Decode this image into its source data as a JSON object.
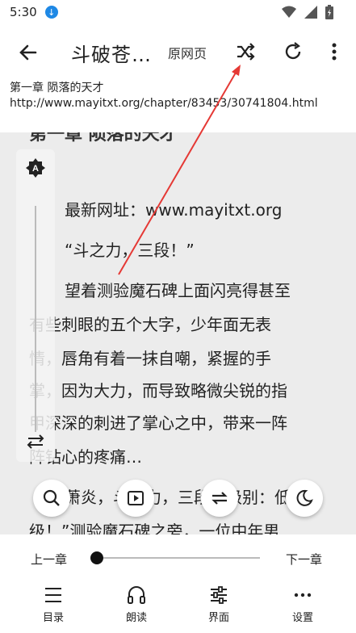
{
  "status": {
    "time": "5:30"
  },
  "toolbar": {
    "title": "斗破苍…",
    "origin_label": "原网页"
  },
  "url_info": {
    "chapter": "第一章 陨落的天才",
    "url": "http://www.mayitxt.org/chapter/83453/30741804.html"
  },
  "reader": {
    "heading": "第一章 陨落的天才",
    "lines": [
      "最新网址：www.mayitxt.org",
      "“斗之力，三段！”",
      "望着测验魔石碑上面闪亮得甚至",
      "有些刺眼的五个大字，少年面无表",
      "情，唇角有着一抹自嘲，紧握的手",
      "掌，因为大力，而导致略微尖锐的指",
      "甲深深的刺进了掌心之中，带来一阵",
      "阵钻心的疼痛…",
      "萧炎，斗之力，三段！级别：低",
      "级！”测验魔石碑之旁，一位中年男"
    ]
  },
  "bottom": {
    "prev_label": "上一章",
    "next_label": "下一章",
    "progress": 0.0,
    "nav": [
      {
        "label": "目录",
        "icon": "list-icon"
      },
      {
        "label": "朗读",
        "icon": "headphones-icon"
      },
      {
        "label": "界面",
        "icon": "sliders-icon"
      },
      {
        "label": "设置",
        "icon": "more-icon"
      }
    ]
  },
  "colors": {
    "accent_arrow": "#e53935",
    "download_badge": "#1e88e5"
  }
}
